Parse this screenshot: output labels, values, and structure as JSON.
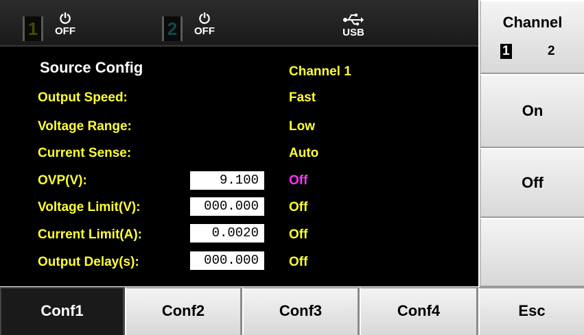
{
  "status_bar": {
    "channel1": {
      "number": "1",
      "state": "OFF"
    },
    "channel2": {
      "number": "2",
      "state": "OFF"
    },
    "usb_label": "USB"
  },
  "panel": {
    "title": "Source Config",
    "channel_header": "Channel 1",
    "rows": [
      {
        "label": "Output Speed:",
        "value": "Fast"
      },
      {
        "label": "Voltage Range:",
        "value": "Low"
      },
      {
        "label": "Current Sense:",
        "value": "Auto"
      },
      {
        "label": "OVP(V):",
        "input": "9.100",
        "value": "Off"
      },
      {
        "label": "Voltage Limit(V):",
        "input": "000.000",
        "value": "Off"
      },
      {
        "label": "Current Limit(A):",
        "input": "0.0020",
        "value": "Off"
      },
      {
        "label": "Output Delay(s):",
        "input": "000.000",
        "value": "Off"
      }
    ]
  },
  "side_keys": {
    "channel_title": "Channel",
    "channel_options": [
      "1",
      "2"
    ],
    "channel_selected": "1",
    "on_label": "On",
    "off_label": "Off",
    "blank_label": ""
  },
  "bottom_keys": {
    "labels": [
      "Conf1",
      "Conf2",
      "Conf3",
      "Conf4",
      "Esc"
    ],
    "selected": "Conf1"
  },
  "colors": {
    "label": "#ffff33",
    "value_highlight": "#ff33ff",
    "channel1_number": "#4a4a00",
    "channel2_number": "#0f4a4a"
  }
}
